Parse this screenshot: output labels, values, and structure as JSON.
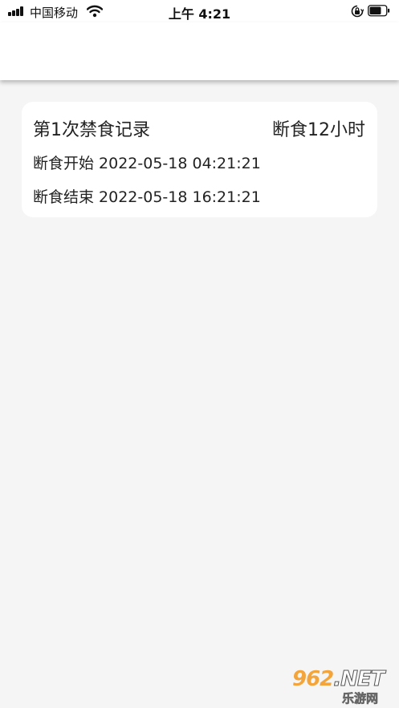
{
  "status_bar": {
    "carrier": "中国移动",
    "time": "上午 4:21"
  },
  "record": {
    "title": "第1次禁食记录",
    "duration": "断食12小时",
    "start_label": "断食开始",
    "start_time": "2022-05-18 04:21:21",
    "end_label": "断食结束",
    "end_time": "2022-05-18 16:21:21"
  },
  "watermark": {
    "brand_number": "962",
    "brand_suffix": ".NET",
    "brand_name": "乐游网"
  },
  "colors": {
    "background": "#f5f5f5",
    "card": "#ffffff",
    "text": "#222222",
    "watermark_accent": "#f3a43a"
  }
}
